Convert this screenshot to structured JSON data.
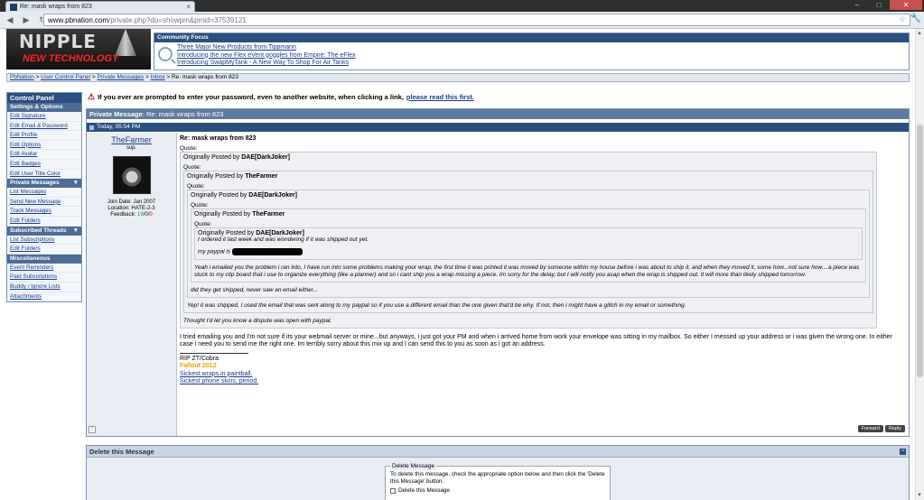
{
  "browser": {
    "tab_title": "Re: mask wraps from 823",
    "url_host": "www.pbnation.com",
    "url_path": "/private.php?do=showpm&pmid=37539121"
  },
  "logo": {
    "line1": "NIPPLE",
    "line2": "NEW TECHNOLOGY"
  },
  "community_focus": {
    "title": "Community Focus",
    "links": [
      "Three Major New Products from Tippmann",
      "Introducing the new Flex eVent goggles from Empire: The eFlex",
      "Introducing SwapMyTank - A New Way To Shop For Air Tanks"
    ]
  },
  "breadcrumb": {
    "items": [
      "PbNation",
      "User Control Panel",
      "Private Messages",
      "Inbox"
    ],
    "current": "Re: mask wraps from 823",
    "sep": ">"
  },
  "sidebar": {
    "title": "Control Panel",
    "sections": [
      {
        "title": "Settings & Options",
        "items": [
          "Edit Signature",
          "Edit Email & Password",
          "Edit Profile",
          "Edit Options",
          "Edit Avatar",
          "Edit Badges",
          "Edit User Title Color"
        ]
      },
      {
        "title": "Private Messages",
        "items": [
          "List Messages",
          "Send New Message",
          "Track Messages",
          "Edit Folders"
        ]
      },
      {
        "title": "Subscribed Threads",
        "items": [
          "List Subscriptions",
          "Edit Folders"
        ]
      },
      {
        "title": "Miscellaneous",
        "items": [
          "Event Reminders",
          "Paid Subscriptions",
          "Buddy / Ignore Lists",
          "Attachments"
        ]
      }
    ]
  },
  "warning": {
    "text": "If you ever are prompted to enter your password, even to another website, when clicking a link,",
    "link": "please read this first."
  },
  "pm": {
    "header_label": "Private Message",
    "header_title": "Re: mask wraps from 823",
    "date": "Today, 05:54 PM",
    "subject": "Re: mask wraps from 823",
    "user": {
      "name": "TheFarmer",
      "title": "sup.",
      "join": "Join Date: Jan 2007",
      "location": "Location: HATE-2-3",
      "feedback_label": "Feedback:",
      "feedback_pos": "19",
      "feedback_neu": "0",
      "feedback_neg": "0"
    },
    "quote_label": "Quote:",
    "originally": "Originally Posted by",
    "author_a": "DAE[DarkJoker]",
    "author_b": "TheFarmer",
    "q_innermost_1": "I ordered it last week and was wondering if it was shipped out yet.",
    "q_innermost_2": "my paypal is",
    "q_level4": "Yeah i emailed you the problem i ran into, I have run into some problems making your wrap, the first time it was printed it was moved by someone within my house before i was about to ship it, and when they moved it, some how...not sure how....a piece was stuck to my clip board that i use to organize everything (like a planner) and so i cant ship you a wrap missing a piece. Im sorry for the delay, but I will notify you asap when the wrap is shipped out. It will more than likely shipped tomorrow.",
    "q_level3": "did they get shipped, never saw an email either...",
    "q_level2": "Yep! it was shipped, I used the email that was sent along to my paypal so if you use a different email than the one given that'd be why. If not, then i might have a glitch in my email or something.",
    "q_level1": "Thought I'd let you know a dispute was open with paypal.",
    "reply": "I tried emailing you and I'm not sure if its your webmail server or mine...but anyways, i just got your PM and when i arrived home from work your envelope was sitting in my mailbox. So either I messed up your address or i was given the wrong one. In either case i need you to send me the right one. Im terribly sorry about this mix up and I can send this to you as soon as i got an address.",
    "sig": {
      "line1": "RIP ZT/Cobra",
      "line2": "Fallout 2012",
      "link1": "Sickest wraps in paintball.",
      "link2": "Sickest phone skins, period."
    },
    "btn_forward": "Forward",
    "btn_reply": "Reply"
  },
  "delete": {
    "title": "Delete this Message",
    "legend": "Delete Message",
    "instructions": "To delete this message, check the appropriate option below and then click the 'Delete this Message' button.",
    "checkbox_label": "Delete this Message"
  }
}
